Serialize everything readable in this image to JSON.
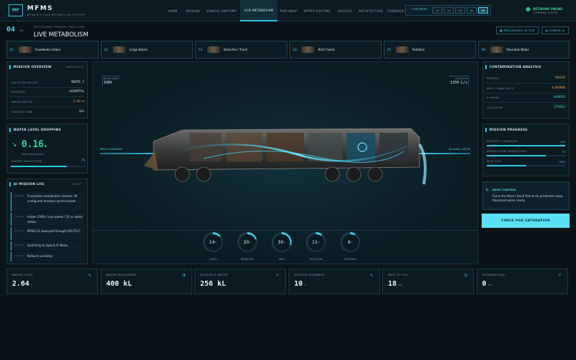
{
  "app": {
    "logo": "MF",
    "title": "MFMS",
    "subtitle": "MOBILE FLOOD METABOLISM SYSTEM"
  },
  "nav": [
    "HOME",
    "MISSION",
    "VEHICLE ANATOMY",
    "LIVE METABOLISM",
    "POD-SWAP",
    "WATER ROUTING",
    "RESULTS",
    "ARCHITECTURE",
    "FEEDBACK"
  ],
  "speed": {
    "label": "SIM SPEED",
    "options": [
      "1x",
      "2x",
      "4x",
      "8x",
      "16x"
    ],
    "selected": "16x"
  },
  "network": {
    "status": "NETWORK ONLINE",
    "sub": "COMMAND CENTER"
  },
  "header": {
    "num": "04",
    "unit": "/06",
    "sub": "PROCESSING STREAM / REAL-TIME",
    "title": "LIVE METABOLISM",
    "badge1": "PROCESSING ACTIVE",
    "badge2": "HYBRID AI"
  },
  "steps": [
    {
      "n": "01",
      "label": "Floodwater Intake"
    },
    {
      "n": "02",
      "label": "Large Debris"
    },
    {
      "n": "03",
      "label": "Branches / Trash"
    },
    {
      "n": "04",
      "label": "Mud / Sand"
    },
    {
      "n": "05",
      "label": "Pollution"
    },
    {
      "n": "06",
      "label": "Reusable Water"
    }
  ],
  "overview": {
    "title": "MISSION OVERVIEW",
    "tag": "MFMS-ROUTE",
    "rows": [
      {
        "k": "SELECTED ROUTE",
        "v": "ROUTE C"
      },
      {
        "k": "PRIORITY",
        "v": "HOSPITAL"
      },
      {
        "k": "WATER DEPTH",
        "v": "2.64 m"
      },
      {
        "k": "MISSION TIME",
        "v": "32s"
      }
    ]
  },
  "waterlevel": {
    "title": "WATER LEVEL DROPPING",
    "value": "0.16",
    "unit": "m",
    "sub": "since deployment",
    "label": "TARGET REDUCTION",
    "pct": "75"
  },
  "ailog": {
    "title": "AI MISSION LOG",
    "tag": "LATEST",
    "entries": [
      {
        "t": "T+00:00",
        "msg": "Floodwater metabolism started. All configured modules synchronized."
      },
      {
        "t": "T+00:01",
        "msg": "Intake 100% / Low speed / 50 m safety radius."
      },
      {
        "t": "T+00:05",
        "msg": "MFMS-22 deployed through ROUTE-C."
      },
      {
        "t": "T+00:07",
        "msg": "Switching to Hybrid AI Mode."
      },
      {
        "t": "T+00:09",
        "msg": "Network unstable."
      }
    ]
  },
  "center": {
    "intake_label": "INTAKE SPEED",
    "intake_value": "100%",
    "flow_label": "FLOW RATE",
    "flow_value": "1250 L/s",
    "left_tag": "RAW FLOODWATER",
    "right_tag": "REUSABLE WATER"
  },
  "gauges": [
    {
      "v": "14",
      "u": "%",
      "l": "LARGE",
      "pct": 0.14
    },
    {
      "v": "20",
      "u": "%",
      "l": "BRANCHES",
      "pct": 0.2
    },
    {
      "v": "30",
      "u": "%",
      "l": "MUD",
      "pct": 0.3
    },
    {
      "v": "11",
      "u": "%",
      "l": "POLLUTION",
      "pct": 0.11
    },
    {
      "v": "9",
      "u": "%",
      "l": "REUSABLE",
      "pct": 0.09
    }
  ],
  "contam": {
    "title": "CONTAMINATION ANALYSIS",
    "rows": [
      {
        "k": "PROFILE",
        "v": "MIXED",
        "c": "#f0a24a"
      },
      {
        "k": "MUD / SAND RATE",
        "v": "4.0E/MIN",
        "c": "#f0a24a"
      },
      {
        "k": "AI MODE",
        "v": "HYBRID",
        "c": "#4ed0ec"
      },
      {
        "k": "ISOLATION",
        "v": "STABLE",
        "c": "#3ad69b"
      }
    ]
  },
  "progress": {
    "title": "MISSION PROGRESS",
    "rows": [
      {
        "k": "PRIORITY CORRIDOR",
        "v": "100",
        "pct": 1.0
      },
      {
        "k": "WATER LEVEL REDUCTION",
        "v": "75",
        "pct": 0.75
      },
      {
        "k": "MUD POD",
        "v": "50%",
        "pct": 0.5
      }
    ]
  },
  "control": {
    "title": "DEMO CONTROL",
    "text": "Force the Mud / Sand Pod to its predicted swap threshold when ready.",
    "button": "FORCE POD SATURATION"
  },
  "kpis": [
    {
      "l": "WATER LEVEL",
      "v": "2.64",
      "u": "m",
      "ic": "∿"
    },
    {
      "l": "WATER PROCESSED",
      "v": "400 kL",
      "u": "",
      "ic": "◔"
    },
    {
      "l": "REUSABLE WATER",
      "v": "256 kL",
      "u": "",
      "ic": "♲"
    },
    {
      "l": "MISSION PROGRESS",
      "v": "10",
      "u": "%",
      "ic": "∿"
    },
    {
      "l": "MUD TO FULL",
      "v": "18",
      "u": "min",
      "ic": "◷"
    },
    {
      "l": "INTERRUPTION",
      "v": "0",
      "u": "sec",
      "ic": "⚡"
    }
  ]
}
